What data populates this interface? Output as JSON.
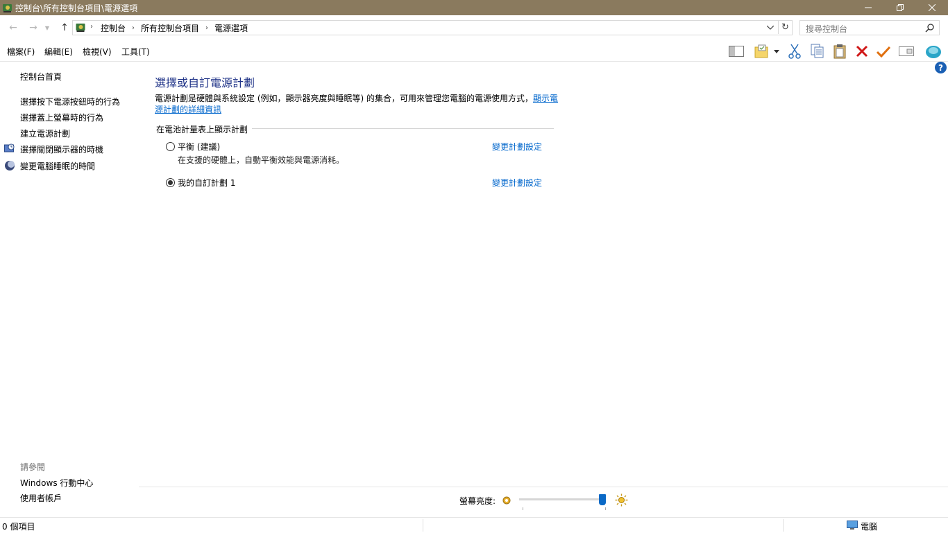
{
  "window": {
    "title": "控制台\\所有控制台項目\\電源選項"
  },
  "address": {
    "crumbs": [
      "控制台",
      "所有控制台項目",
      "電源選項"
    ],
    "search_placeholder": "搜尋控制台"
  },
  "menu": {
    "items": [
      "檔案(F)",
      "編輯(E)",
      "檢視(V)",
      "工具(T)"
    ]
  },
  "toolbar": {
    "icons": [
      "preview-pane-icon",
      "new-folder-icon",
      "cut-icon",
      "copy-icon",
      "paste-icon",
      "delete-icon",
      "checkmark-icon",
      "rename-icon",
      "shell-icon"
    ]
  },
  "sidebar": {
    "home": "控制台首頁",
    "links": [
      "選擇按下電源按鈕時的行為",
      "選擇蓋上螢幕時的行為",
      "建立電源計劃",
      "選擇關閉顯示器的時機",
      "變更電腦睡眠的時間"
    ],
    "see_also_title": "請參閱",
    "see_also": [
      "Windows 行動中心",
      "使用者帳戶"
    ]
  },
  "main": {
    "title": "選擇或自訂電源計劃",
    "description": "電源計劃是硬體與系統設定 (例如，顯示器亮度與睡眠等) 的集合，可用來管理您電腦的電源使用方式，",
    "description_link": "顯示電源計劃的詳細資訊",
    "section_heading": "在電池計量表上顯示計劃",
    "plans": [
      {
        "name": "平衡 (建議)",
        "description": "在支援的硬體上，自動平衡效能與電源消耗。",
        "selected": false,
        "link": "變更計劃設定"
      },
      {
        "name": "我的自訂計劃 1",
        "description": "",
        "selected": true,
        "link": "變更計劃設定"
      }
    ]
  },
  "brightness": {
    "label": "螢幕亮度:",
    "value_percent": 100
  },
  "status": {
    "items_text": "0 個項目",
    "computer_label": "電腦"
  },
  "colors": {
    "titlebar": "#8a7a5e",
    "heading": "#1e3287",
    "link": "#0066cc",
    "slider_thumb": "#0a69c6"
  }
}
